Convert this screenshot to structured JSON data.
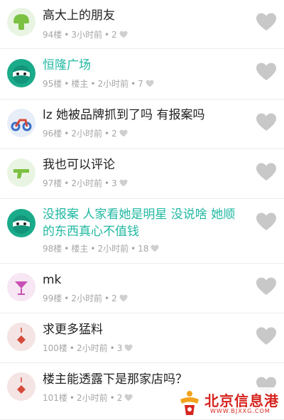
{
  "comments": [
    {
      "text": "高大上的朋友",
      "floor": "94楼",
      "author_tag": "",
      "time": "3小时前",
      "likes": "2",
      "avatar_icon": "mushroom-icon",
      "is_op": false
    },
    {
      "text": "恒隆广场",
      "floor": "95楼",
      "author_tag": "楼主",
      "time": "2小时前",
      "likes": "7",
      "avatar_icon": "ninja-icon",
      "is_op": true
    },
    {
      "text": "lz 她被品牌抓到了吗 有报案吗",
      "floor": "96楼",
      "author_tag": "",
      "time": "2小时前",
      "likes": "2",
      "avatar_icon": "motorcycle-icon",
      "is_op": false
    },
    {
      "text": "我也可以评论",
      "floor": "97楼",
      "author_tag": "",
      "time": "2小时前",
      "likes": "3",
      "avatar_icon": "gun-icon",
      "is_op": false
    },
    {
      "text": "没报案 人家看她是明星 没说啥 她顺的东西真心不值钱",
      "floor": "98楼",
      "author_tag": "楼主",
      "time": "2小时前",
      "likes": "18",
      "avatar_icon": "ninja-icon",
      "is_op": true
    },
    {
      "text": "mk",
      "floor": "99楼",
      "author_tag": "",
      "time": "2小时前",
      "likes": "2",
      "avatar_icon": "cocktail-icon",
      "is_op": false
    },
    {
      "text": "求更多猛料",
      "floor": "100楼",
      "author_tag": "",
      "time": "2小时前",
      "likes": "3",
      "avatar_icon": "playing-card-icon",
      "is_op": false
    },
    {
      "text": "楼主能透露下是那家店吗？",
      "floor": "101楼",
      "author_tag": "",
      "time": "2小时前",
      "likes": "2",
      "avatar_icon": "playing-card-icon",
      "is_op": false
    }
  ],
  "separator": "•",
  "watermark": {
    "title": "北京信息港",
    "url": "WWW.BJXXG.COM"
  },
  "colors": {
    "op_text": "#21b8a2",
    "meta": "#a6a6a6",
    "like_heart": "#c8c8c8",
    "op_avatar": "#1aab8a",
    "watermark": "#d6251f"
  }
}
